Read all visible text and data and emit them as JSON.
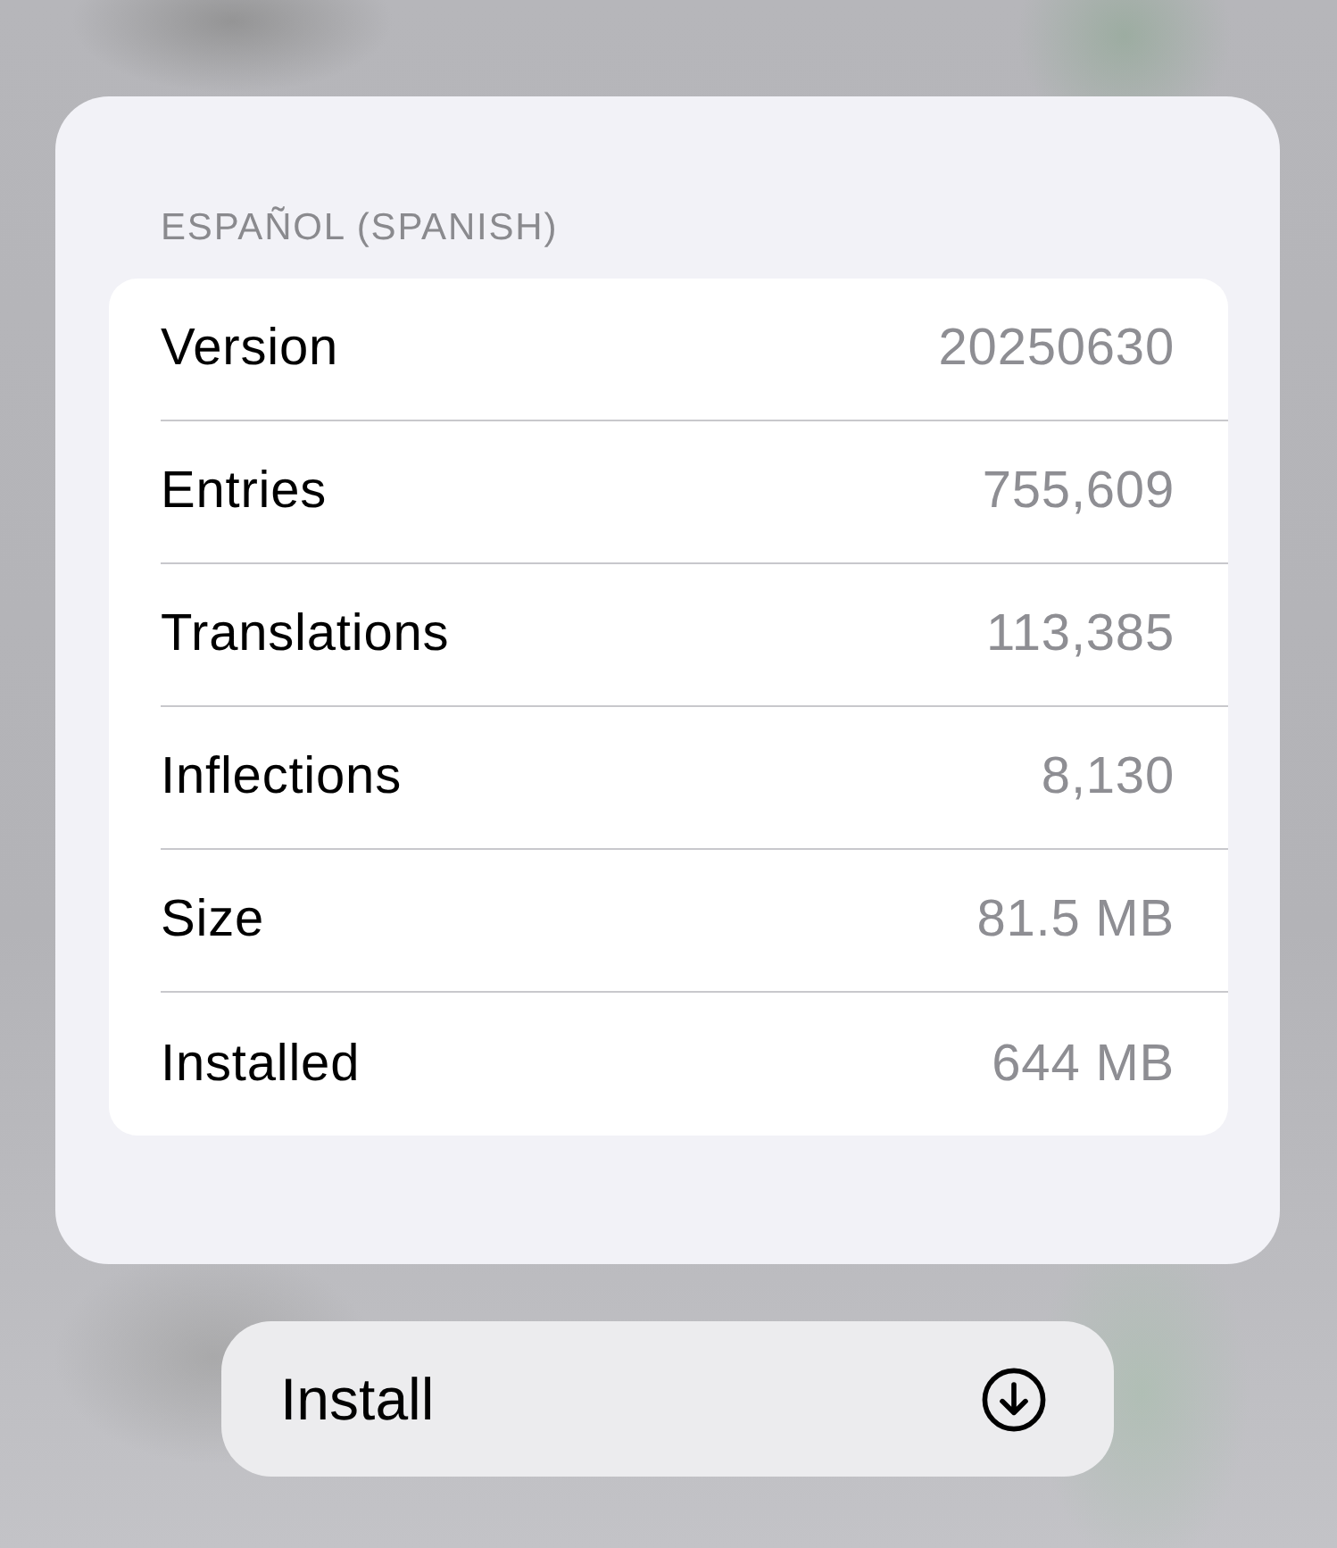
{
  "dictionary_card": {
    "header": "ESPAÑOL (SPANISH)",
    "rows": [
      {
        "label": "Version",
        "value": "20250630"
      },
      {
        "label": "Entries",
        "value": "755,609"
      },
      {
        "label": "Translations",
        "value": "113,385"
      },
      {
        "label": "Inflections",
        "value": "8,130"
      },
      {
        "label": "Size",
        "value": "81.5 MB"
      },
      {
        "label": "Installed",
        "value": "644 MB"
      }
    ]
  },
  "install_button": {
    "label": "Install"
  }
}
